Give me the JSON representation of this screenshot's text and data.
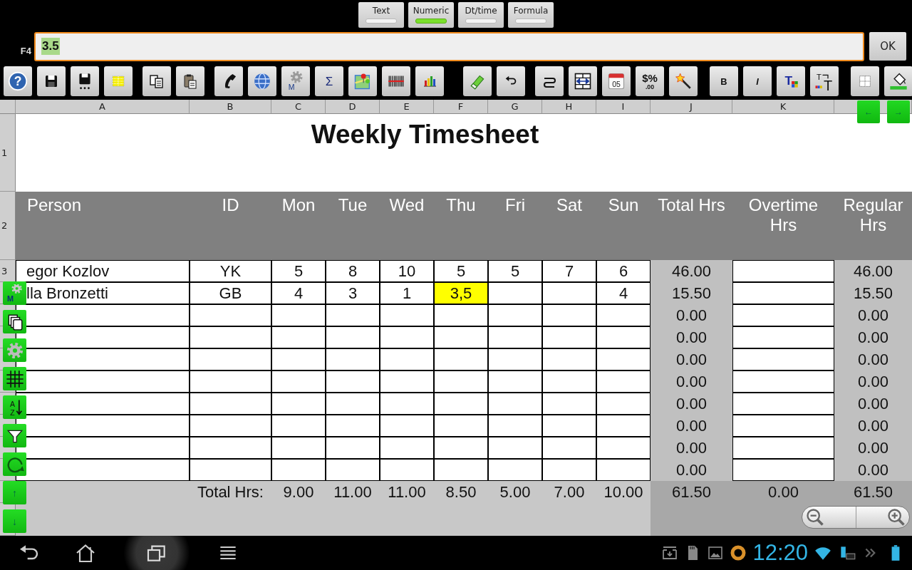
{
  "input_types": [
    {
      "label": "Text",
      "selected": false
    },
    {
      "label": "Numeric",
      "selected": true
    },
    {
      "label": "Dt/time",
      "selected": false
    },
    {
      "label": "Formula",
      "selected": false
    }
  ],
  "formula_bar": {
    "cell_ref": "F4",
    "value": "3.5",
    "ok": "OK"
  },
  "toolbar": [
    {
      "kind": "help",
      "label": "?"
    },
    {
      "kind": "save"
    },
    {
      "kind": "save-as"
    },
    {
      "kind": "grid-select"
    },
    {
      "kind": "copy"
    },
    {
      "kind": "paste"
    },
    {
      "kind": "phone"
    },
    {
      "kind": "globe"
    },
    {
      "kind": "macro",
      "label": "M"
    },
    {
      "kind": "sum",
      "label": "Σ"
    },
    {
      "kind": "map"
    },
    {
      "kind": "barcode"
    },
    {
      "kind": "chart"
    },
    {
      "kind": "eraser"
    },
    {
      "kind": "undo"
    },
    {
      "kind": "wrap"
    },
    {
      "kind": "resize-column"
    },
    {
      "kind": "calendar",
      "label": "05"
    },
    {
      "kind": "currency",
      "label": "$%",
      "sublabel": ".00"
    },
    {
      "kind": "wand"
    },
    {
      "kind": "bold",
      "label": "B"
    },
    {
      "kind": "italic",
      "label": "I"
    },
    {
      "kind": "text-color",
      "label": "T"
    },
    {
      "kind": "text-size",
      "label": "T",
      "sublabel": "T"
    },
    {
      "kind": "borders"
    },
    {
      "kind": "fill"
    }
  ],
  "sheet": {
    "columns": [
      "A",
      "B",
      "C",
      "D",
      "E",
      "F",
      "G",
      "H",
      "I",
      "J",
      "K"
    ],
    "title_row": {
      "header": "1",
      "title": "Weekly Timesheet"
    },
    "header_row": {
      "header": "2",
      "labels": [
        "Person",
        "ID",
        "Mon",
        "Tue",
        "Wed",
        "Thu",
        "Fri",
        "Sat",
        "Sun",
        "Total Hrs",
        "Overtime Hrs",
        "Regular Hrs"
      ]
    },
    "rows": [
      {
        "header": "3",
        "person": "egor Kozlov",
        "id": "YK",
        "days": [
          {
            "value": "5",
            "selected": false
          },
          {
            "value": "8",
            "selected": false
          },
          {
            "value": "10",
            "selected": false
          },
          {
            "value": "5",
            "selected": false
          },
          {
            "value": "5",
            "selected": false
          },
          {
            "value": "7",
            "selected": false
          },
          {
            "value": "6",
            "selected": false
          }
        ],
        "total": "46.00",
        "regular": "46.00"
      },
      {
        "person": "lla Bronzetti",
        "id": "GB",
        "days": [
          {
            "value": "4",
            "selected": false
          },
          {
            "value": "3",
            "selected": false
          },
          {
            "value": "1",
            "selected": false
          },
          {
            "value": "3,5",
            "selected": true
          },
          {
            "selected": false
          },
          {
            "selected": false
          },
          {
            "value": "4",
            "selected": false
          }
        ],
        "total": "15.50",
        "regular": "15.50"
      },
      {
        "days": [
          {
            "selected": false
          },
          {
            "selected": false
          },
          {
            "selected": false
          },
          {
            "selected": false
          },
          {
            "selected": false
          },
          {
            "selected": false
          },
          {
            "selected": false
          }
        ],
        "total": "0.00",
        "regular": "0.00"
      },
      {
        "days": [
          {
            "selected": false
          },
          {
            "selected": false
          },
          {
            "selected": false
          },
          {
            "selected": false
          },
          {
            "selected": false
          },
          {
            "selected": false
          },
          {
            "selected": false
          }
        ],
        "total": "0.00",
        "regular": "0.00"
      },
      {
        "days": [
          {
            "selected": false
          },
          {
            "selected": false
          },
          {
            "selected": false
          },
          {
            "selected": false
          },
          {
            "selected": false
          },
          {
            "selected": false
          },
          {
            "selected": false
          }
        ],
        "total": "0.00",
        "regular": "0.00"
      },
      {
        "days": [
          {
            "selected": false
          },
          {
            "selected": false
          },
          {
            "selected": false
          },
          {
            "selected": false
          },
          {
            "selected": false
          },
          {
            "selected": false
          },
          {
            "selected": false
          }
        ],
        "total": "0.00",
        "regular": "0.00"
      },
      {
        "days": [
          {
            "selected": false
          },
          {
            "selected": false
          },
          {
            "selected": false
          },
          {
            "selected": false
          },
          {
            "selected": false
          },
          {
            "selected": false
          },
          {
            "selected": false
          }
        ],
        "total": "0.00",
        "regular": "0.00"
      },
      {
        "days": [
          {
            "selected": false
          },
          {
            "selected": false
          },
          {
            "selected": false
          },
          {
            "selected": false
          },
          {
            "selected": false
          },
          {
            "selected": false
          },
          {
            "selected": false
          }
        ],
        "total": "0.00",
        "regular": "0.00"
      },
      {
        "days": [
          {
            "selected": false
          },
          {
            "selected": false
          },
          {
            "selected": false
          },
          {
            "selected": false
          },
          {
            "selected": false
          },
          {
            "selected": false
          },
          {
            "selected": false
          }
        ],
        "total": "0.00",
        "regular": "0.00"
      },
      {
        "days": [
          {
            "selected": false
          },
          {
            "selected": false
          },
          {
            "selected": false
          },
          {
            "selected": false
          },
          {
            "selected": false
          },
          {
            "selected": false
          },
          {
            "selected": false
          }
        ],
        "total": "0.00",
        "regular": "0.00"
      }
    ],
    "totals": {
      "label": "Total Hrs:",
      "days": [
        "9.00",
        "11.00",
        "11.00",
        "8.50",
        "5.00",
        "7.00",
        "10.00"
      ],
      "total": "61.50",
      "overtime": "0.00",
      "regular": "61.50"
    }
  },
  "scroll_buttons": [
    "←",
    "→"
  ],
  "side_buttons": [
    {
      "kind": "macro",
      "label": "M"
    },
    {
      "kind": "copy"
    },
    {
      "kind": "settings"
    },
    {
      "kind": "grid"
    },
    {
      "kind": "sort",
      "label": "A",
      "sublabel": "Z"
    },
    {
      "kind": "filter"
    },
    {
      "kind": "refresh"
    },
    {
      "kind": "up",
      "label": "↑"
    },
    {
      "kind": "down",
      "label": "↓"
    }
  ],
  "status_bar": {
    "time": "12:20"
  }
}
